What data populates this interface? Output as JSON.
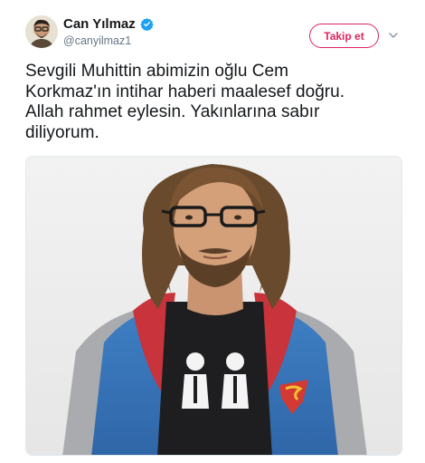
{
  "user": {
    "display_name": "Can Yılmaz",
    "handle": "@canyilmaz1",
    "verified": true,
    "avatar_icon": "user-avatar"
  },
  "actions": {
    "follow_label": "Takip et",
    "follow_color": "#e0245e",
    "menu_icon": "chevron-down-icon"
  },
  "tweet": {
    "line1": "Sevgili Muhittin abimizin oğlu Cem",
    "line2": "Korkmaz'ın intihar haberi maalesef doğru.",
    "line3": "Allah rahmet eylesin. Yakınlarına sabır",
    "line4": "diliyorum."
  },
  "media": {
    "type": "photo"
  }
}
